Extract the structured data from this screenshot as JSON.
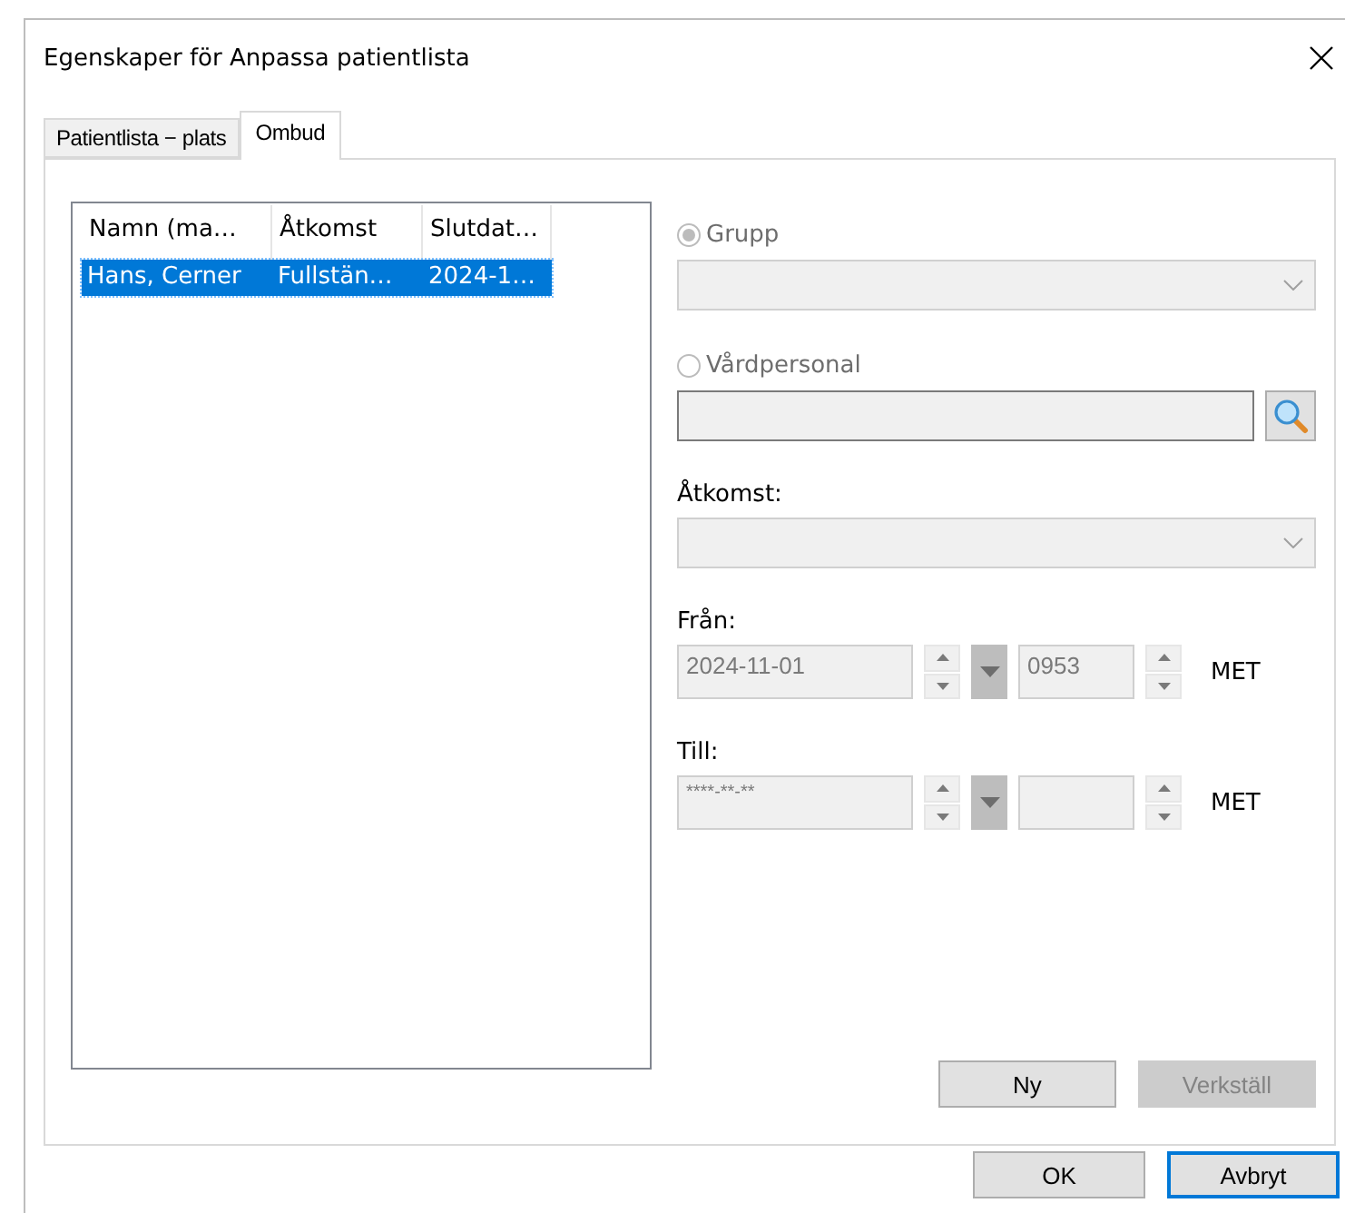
{
  "window": {
    "title": "Egenskaper för Anpassa patientlista"
  },
  "tabs": [
    {
      "label": "Patientlista − plats",
      "selected": false
    },
    {
      "label": "Ombud",
      "selected": true
    }
  ],
  "list": {
    "columns": [
      "Namn (ma…",
      "Åtkomst",
      "Slutdat…"
    ],
    "rows": [
      {
        "cells": [
          "Hans, Cerner",
          "Fullstän…",
          "2024-1…"
        ],
        "selected": true
      }
    ]
  },
  "form": {
    "radios": [
      {
        "label": "Grupp",
        "selected": true
      },
      {
        "label": "Vårdpersonal",
        "selected": false
      }
    ],
    "access_label": "Åtkomst:",
    "from": {
      "label": "Från:",
      "date": "2024-11-01",
      "time": "0953",
      "zone": "MET"
    },
    "to": {
      "label": "Till:",
      "date": "****-**-**",
      "zone": "MET"
    }
  },
  "panel_buttons": [
    {
      "label": "Ny",
      "disabled": false
    },
    {
      "label": "Verkställ",
      "disabled": true
    }
  ],
  "dialog_buttons": [
    {
      "label": "OK",
      "default": false
    },
    {
      "label": "Avbryt",
      "default": true
    }
  ]
}
